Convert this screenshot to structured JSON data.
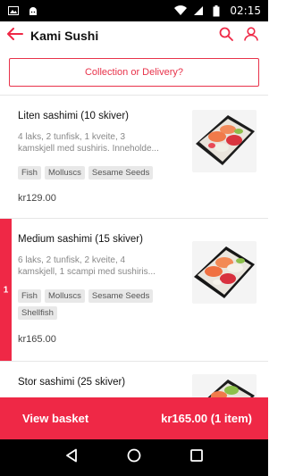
{
  "status_bar": {
    "time": "02:15",
    "icons": [
      "image-icon",
      "android-icon",
      "wifi-icon",
      "signal-icon",
      "battery-icon"
    ]
  },
  "header": {
    "title": "Kami Sushi",
    "icons": [
      "back-arrow-icon",
      "search-icon",
      "account-icon"
    ]
  },
  "delivery_button": "Collection or Delivery?",
  "menu": {
    "items": [
      {
        "title": "Liten sashimi (10 skiver)",
        "desc_lines": [
          "4 laks, 2 tunfisk, 1 kveite, 3",
          "kamskjell med sushiris. Inneholde..."
        ],
        "tags": [
          "Fish",
          "Molluscs",
          "Sesame Seeds"
        ],
        "price": "kr129.00"
      },
      {
        "title": "Medium sashimi (15 skiver)",
        "desc_lines": [
          "6 laks, 2 tunfisk, 2 kveite, 4",
          "kamskjell, 1 scampi med sushiris..."
        ],
        "tags": [
          "Fish",
          "Molluscs",
          "Sesame Seeds",
          "Shellfish"
        ],
        "price": "kr165.00",
        "quantity": "1"
      },
      {
        "title": "Stor sashimi (25 skiver)"
      }
    ]
  },
  "basket": {
    "label": "View basket",
    "total": "kr165.00 (1 item)"
  },
  "colors": {
    "accent": "#ef2846",
    "outline_accent": "#e8324a"
  }
}
